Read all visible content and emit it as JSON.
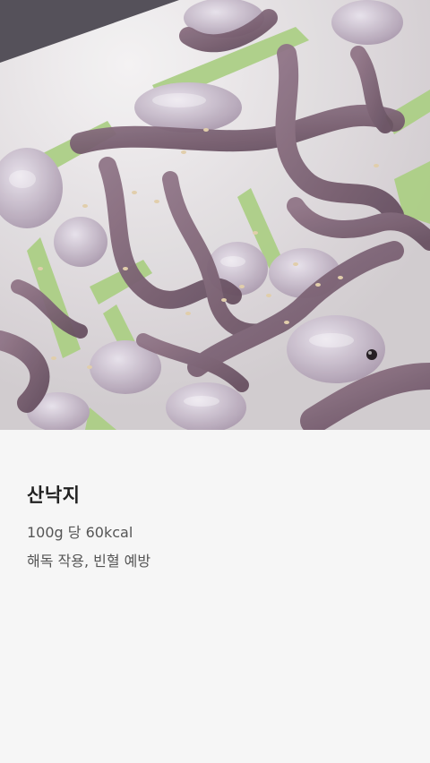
{
  "food": {
    "name": "산낙지",
    "calories": "100g 당 60kcal",
    "benefits": "해독 작용, 빈혈 예방"
  },
  "photo": {
    "subject": "raw-octopus-dish",
    "colors": {
      "plate": "#e9e6e8",
      "octopus": "#7d6474",
      "octopus_light": "#c9bccb",
      "cucumber": "#9fc67a",
      "sesame": "#d8c3a0"
    }
  }
}
